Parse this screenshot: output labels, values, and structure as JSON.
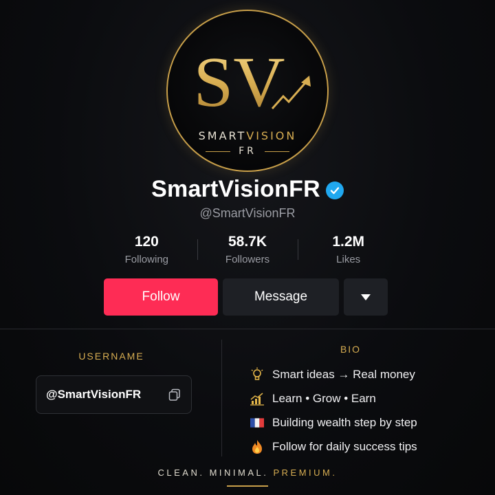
{
  "logo": {
    "monogram": "SV",
    "word_white": "SMART",
    "word_gold": "VISION",
    "sub": "FR",
    "icon": "trend-arrow-icon"
  },
  "profile": {
    "display_name": "SmartVisionFR",
    "verified_icon": "verified-badge-icon",
    "handle": "@SmartVisionFR"
  },
  "stats": [
    {
      "value": "120",
      "label": "Following"
    },
    {
      "value": "58.7K",
      "label": "Followers"
    },
    {
      "value": "1.2M",
      "label": "Likes"
    }
  ],
  "actions": {
    "follow_label": "Follow",
    "message_label": "Message",
    "more_icon": "caret-down-icon"
  },
  "username_section": {
    "title": "USERNAME",
    "value": "@SmartVisionFR",
    "copy_icon": "copy-icon"
  },
  "bio": {
    "title": "BIO",
    "lines": [
      {
        "icon": "lightbulb-icon",
        "text": "Smart ideas → Real money"
      },
      {
        "icon": "chart-icon",
        "text": "Learn • Grow • Earn"
      },
      {
        "icon": "france-flag-icon",
        "text": "Building wealth step by step"
      },
      {
        "icon": "fire-icon",
        "text": "Follow for daily success tips"
      }
    ]
  },
  "tagline": {
    "part1": "CLEAN. MINIMAL. ",
    "part2": "PREMIUM."
  },
  "colors": {
    "gold": "#d8ae52",
    "follow_button": "#fe2c55",
    "verified": "#20a8f0"
  }
}
